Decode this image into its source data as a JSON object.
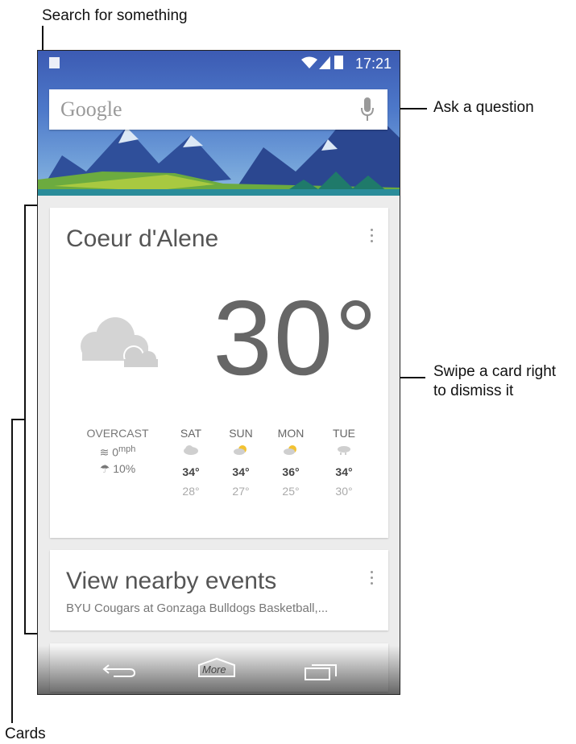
{
  "callouts": {
    "search": "Search for something",
    "ask": "Ask a question",
    "swipe_line1": "Swipe a card right",
    "swipe_line2": "to dismiss it",
    "cards": "Cards"
  },
  "status_bar": {
    "time": "17:21"
  },
  "search_bar": {
    "logo_text": "Google",
    "icon": "mic-icon"
  },
  "weather_card": {
    "city": "Coeur d'Alene",
    "temperature": "30°",
    "condition_icon": "cloud-icon",
    "condition": "OVERCAST",
    "wind_value": "0",
    "wind_unit": "mph",
    "precip": "10%",
    "forecast": [
      {
        "day": "SAT",
        "high": "34°",
        "low": "28°",
        "icon": "cloudy-icon"
      },
      {
        "day": "SUN",
        "high": "34°",
        "low": "27°",
        "icon": "partly-sunny-icon"
      },
      {
        "day": "MON",
        "high": "36°",
        "low": "25°",
        "icon": "partly-sunny-icon"
      },
      {
        "day": "TUE",
        "high": "34°",
        "low": "30°",
        "icon": "rain-snow-icon"
      }
    ]
  },
  "events_card": {
    "title": "View nearby events",
    "subtitle": "BYU Cougars at Gonzaga Bulldogs Basketball,..."
  },
  "nav_bar": {
    "more_label": "More"
  },
  "colors": {
    "header_blue": "#4d78c9",
    "card_bg": "#ffffff",
    "page_bg": "#ececec"
  }
}
